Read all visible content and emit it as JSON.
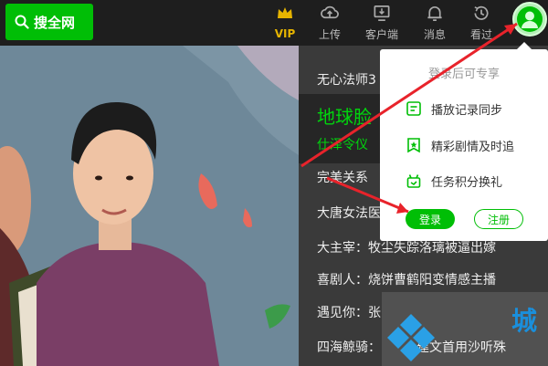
{
  "topbar": {
    "search_label": "搜全网",
    "nav": [
      {
        "label": "VIP",
        "icon": "crown-icon"
      },
      {
        "label": "上传",
        "icon": "cloud-upload-icon"
      },
      {
        "label": "客户端",
        "icon": "monitor-download-icon"
      },
      {
        "label": "消息",
        "icon": "bell-icon"
      },
      {
        "label": "看过",
        "icon": "history-icon"
      }
    ],
    "avatar_icon": "user-avatar-icon"
  },
  "playlist": {
    "items": [
      "无心法师3",
      "完美关系",
      "大唐女法医",
      "大主宰：牧尘失踪洛璃被逼出嫁",
      "喜剧人：烧饼曹鹤阳变情感主播",
      "遇见你：张",
      "四海鲸骑：",
      "建文首用沙听殊"
    ],
    "active_title": "地球脸",
    "active_sub": "仕泽令仪"
  },
  "login_popup": {
    "header": "登录后可专享",
    "features": [
      {
        "label": "播放记录同步",
        "icon": "history-sync-icon"
      },
      {
        "label": "精彩剧情及时追",
        "icon": "star-bookmark-icon"
      },
      {
        "label": "任务积分换礼",
        "icon": "gift-icon"
      }
    ],
    "login_label": "登录",
    "register_label": "注册"
  },
  "watermark_text": "城",
  "colors": {
    "brand_green": "#00be06",
    "vip_gold": "#e6b400",
    "arrow_red": "#e8232b"
  }
}
